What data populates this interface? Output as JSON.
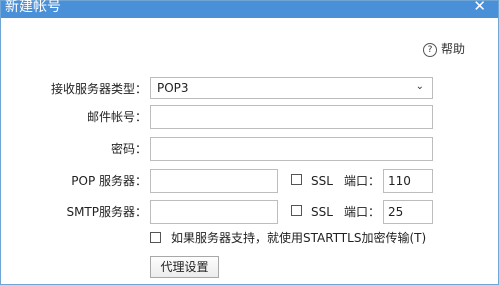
{
  "window": {
    "title": "新建帐号",
    "close_icon": "close-icon"
  },
  "help": {
    "icon": "help-circle-icon",
    "label": "帮助"
  },
  "form": {
    "server_type": {
      "label": "接收服务器类型：",
      "value": "POP3"
    },
    "email_account": {
      "label": "邮件帐号：",
      "value": ""
    },
    "password": {
      "label": "密码：",
      "value": ""
    },
    "pop_server": {
      "label": "POP 服务器：",
      "value": "",
      "ssl_label": "SSL",
      "port_label": "端口：",
      "port_value": "110",
      "ssl_checked": false
    },
    "smtp_server": {
      "label": "SMTP服务器：",
      "value": "",
      "ssl_label": "SSL",
      "port_label": "端口：",
      "port_value": "25",
      "ssl_checked": false
    },
    "starttls": {
      "label": "如果服务器支持，就使用STARTTLS加密传输(T)",
      "checked": false
    },
    "proxy_button": "代理设置"
  },
  "colors": {
    "titlebar": "#4a90d9",
    "border": "#bdbdbd"
  }
}
